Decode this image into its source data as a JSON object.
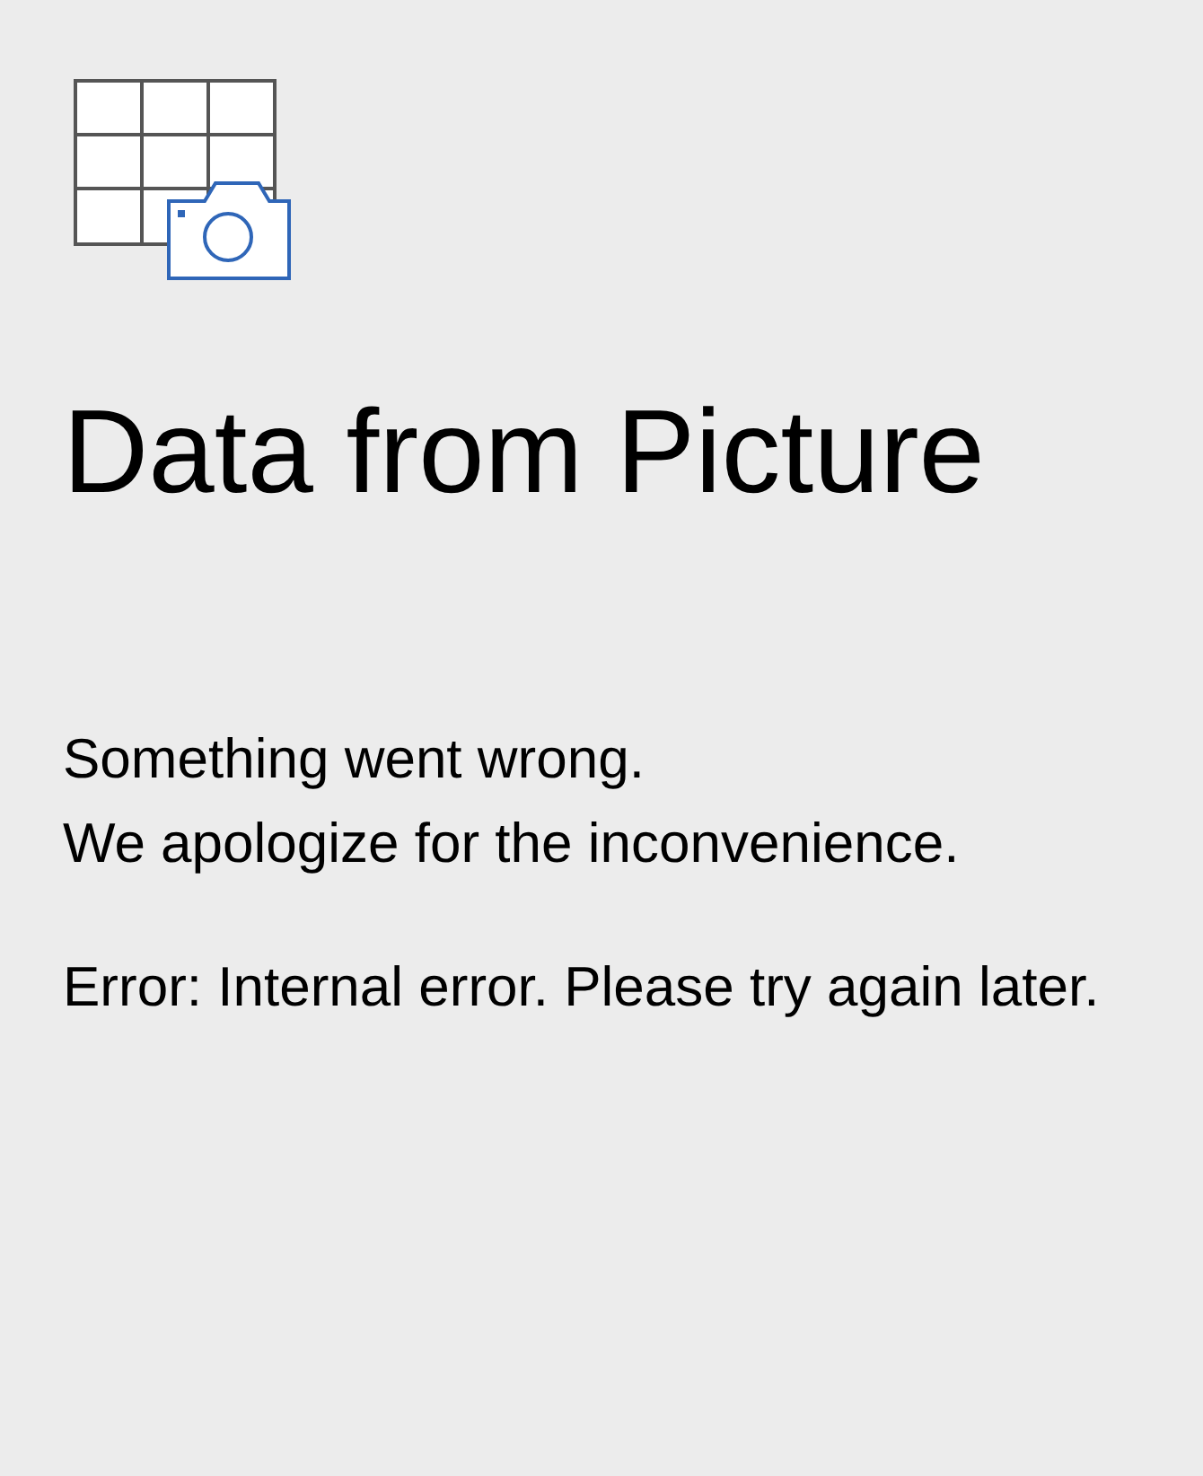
{
  "title": "Data from Picture",
  "messages": [
    "Something went wrong.",
    "We apologize for the inconvenience."
  ],
  "error": "Error: Internal error. Please try again later."
}
